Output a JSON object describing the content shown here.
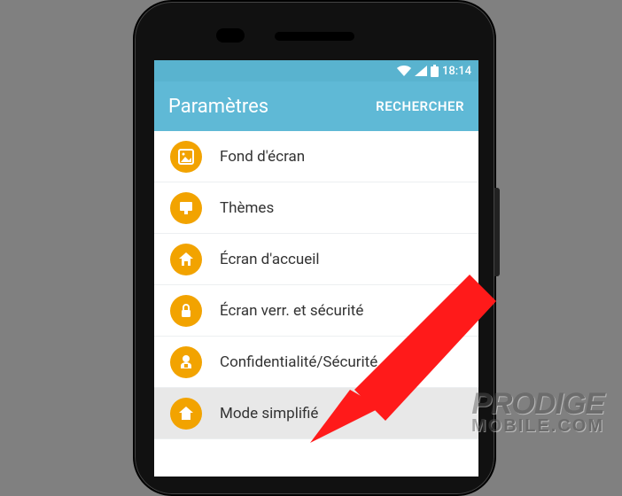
{
  "status": {
    "time": "18:14"
  },
  "header": {
    "title": "Paramètres",
    "search_label": "RECHERCHER"
  },
  "settings": {
    "items": [
      {
        "label": "Fond d'écran",
        "icon": "wallpaper",
        "highlight": false
      },
      {
        "label": "Thèmes",
        "icon": "themes",
        "highlight": false
      },
      {
        "label": "Écran d'accueil",
        "icon": "home",
        "highlight": false
      },
      {
        "label": "Écran verr. et sécurité",
        "icon": "lock",
        "highlight": false
      },
      {
        "label": "Confidentialité/Sécurité",
        "icon": "privacy",
        "highlight": false
      },
      {
        "label": "Mode simplifié",
        "icon": "simple-home",
        "highlight": true
      }
    ]
  },
  "watermark": {
    "line1": "PRODIGE",
    "line2": "MOBILE.COM"
  },
  "colors": {
    "accent": "#5fb9d6",
    "icon_bg": "#f2a300",
    "arrow": "#ff1a1a"
  }
}
